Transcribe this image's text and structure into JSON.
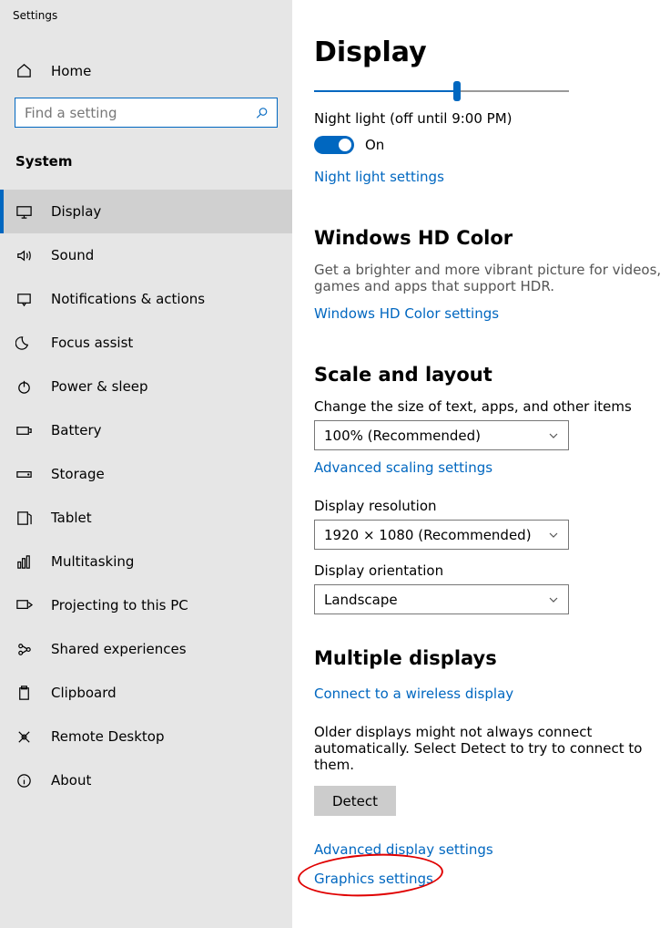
{
  "window_title": "Settings",
  "sidebar": {
    "home_label": "Home",
    "search_placeholder": "Find a setting",
    "section_label": "System",
    "items": [
      {
        "label": "Display",
        "icon": "monitor",
        "selected": true
      },
      {
        "label": "Sound",
        "icon": "sound"
      },
      {
        "label": "Notifications & actions",
        "icon": "notifications"
      },
      {
        "label": "Focus assist",
        "icon": "moon"
      },
      {
        "label": "Power & sleep",
        "icon": "power"
      },
      {
        "label": "Battery",
        "icon": "battery"
      },
      {
        "label": "Storage",
        "icon": "storage"
      },
      {
        "label": "Tablet",
        "icon": "tablet"
      },
      {
        "label": "Multitasking",
        "icon": "multitasking"
      },
      {
        "label": "Projecting to this PC",
        "icon": "projecting"
      },
      {
        "label": "Shared experiences",
        "icon": "shared"
      },
      {
        "label": "Clipboard",
        "icon": "clipboard"
      },
      {
        "label": "Remote Desktop",
        "icon": "remote"
      },
      {
        "label": "About",
        "icon": "about"
      }
    ]
  },
  "main": {
    "title": "Display",
    "night_light_label": "Night light (off until 9:00 PM)",
    "toggle_state": "On",
    "night_light_settings_link": "Night light settings",
    "hd_color": {
      "heading": "Windows HD Color",
      "desc": "Get a brighter and more vibrant picture for videos, games and apps that support HDR.",
      "link": "Windows HD Color settings"
    },
    "scale": {
      "heading": "Scale and layout",
      "size_label": "Change the size of text, apps, and other items",
      "size_value": "100% (Recommended)",
      "advanced_link": "Advanced scaling settings",
      "res_label": "Display resolution",
      "res_value": "1920 × 1080 (Recommended)",
      "orient_label": "Display orientation",
      "orient_value": "Landscape"
    },
    "multi": {
      "heading": "Multiple displays",
      "wireless_link": "Connect to a wireless display",
      "older_text": "Older displays might not always connect automatically. Select Detect to try to connect to them.",
      "detect_label": "Detect",
      "adv_link": "Advanced display settings",
      "gfx_link": "Graphics settings"
    }
  }
}
